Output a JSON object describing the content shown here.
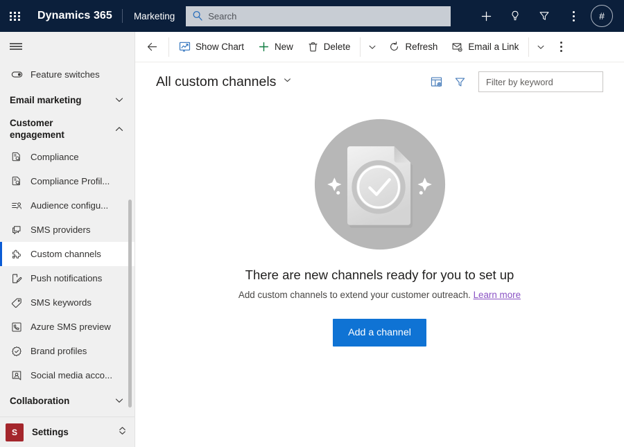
{
  "topbar": {
    "waffle_icon": "app-launcher-icon",
    "brand": "Dynamics 365",
    "app_name": "Marketing",
    "search": {
      "placeholder": "Search",
      "value": "",
      "icon": "search-icon"
    },
    "actions": [
      {
        "name": "quick-create",
        "icon": "plus-icon"
      },
      {
        "name": "assistant",
        "icon": "lightbulb-icon"
      },
      {
        "name": "filter",
        "icon": "funnel-icon"
      },
      {
        "name": "settings-more",
        "icon": "more-vertical-icon"
      }
    ],
    "avatar_text": "#"
  },
  "sidebar": {
    "hamburger_icon": "hamburger-menu-icon",
    "top_items": [
      {
        "label": "Feature switches",
        "icon": "toggle-switch-icon"
      }
    ],
    "groups": [
      {
        "title": "Email marketing",
        "expanded": false,
        "chevron": "chevron-down-icon",
        "items": []
      },
      {
        "title": "Customer engagement",
        "expanded": true,
        "chevron": "chevron-up-icon",
        "items": [
          {
            "label": "Compliance",
            "icon": "document-search-icon",
            "selected": false
          },
          {
            "label": "Compliance Profil...",
            "icon": "document-search-icon",
            "selected": false
          },
          {
            "label": "Audience configu...",
            "icon": "audience-config-icon",
            "selected": false
          },
          {
            "label": "SMS providers",
            "icon": "chat-bubble-icon",
            "selected": false
          },
          {
            "label": "Custom channels",
            "icon": "puzzle-piece-icon",
            "selected": true
          },
          {
            "label": "Push notifications",
            "icon": "push-notification-icon",
            "selected": false
          },
          {
            "label": "SMS keywords",
            "icon": "tag-icon",
            "selected": false
          },
          {
            "label": "Azure SMS preview",
            "icon": "azure-sms-icon",
            "selected": false
          },
          {
            "label": "Brand profiles",
            "icon": "verified-badge-icon",
            "selected": false
          },
          {
            "label": "Social media acco...",
            "icon": "social-account-icon",
            "selected": false
          }
        ]
      },
      {
        "title": "Collaboration",
        "expanded": false,
        "chevron": "chevron-down-icon",
        "items": []
      }
    ],
    "footer": {
      "badge": "S",
      "label": "Settings",
      "chevron": "chevron-up-down-icon",
      "badge_color": "#a4262c"
    }
  },
  "commandbar": {
    "back_icon": "arrow-left-icon",
    "commands": [
      {
        "label": "Show Chart",
        "icon": "show-chart-icon",
        "color": "#2a6fbb"
      },
      {
        "label": "New",
        "icon": "plus-icon",
        "color": "#107c41"
      },
      {
        "label": "Delete",
        "icon": "trash-icon",
        "color": "#3b3a39"
      }
    ],
    "overflow_chevron_1": "chevron-down-icon",
    "commands2": [
      {
        "label": "Refresh",
        "icon": "refresh-icon",
        "color": "#3b3a39"
      },
      {
        "label": "Email a Link",
        "icon": "email-link-icon",
        "color": "#3b3a39"
      }
    ],
    "overflow_chevron_2": "chevron-down-icon",
    "more_icon": "more-vertical-icon"
  },
  "pageheader": {
    "view_title": "All custom channels",
    "view_chevron": "chevron-down-icon",
    "edit_columns_icon": "edit-columns-icon",
    "edit_filters_icon": "edit-filters-icon",
    "keyword_filter": {
      "placeholder": "Filter by keyword",
      "value": ""
    },
    "icon_color": "#4a7ebb"
  },
  "empty_state": {
    "illustration": "document-check-circle-illustration",
    "title": "There are new channels ready for you to set up",
    "subtitle": "Add custom channels to extend your customer outreach.",
    "link_text": "Learn more",
    "link_color": "#8a52c4",
    "button_label": "Add a channel",
    "button_color": "#0f73d4"
  }
}
